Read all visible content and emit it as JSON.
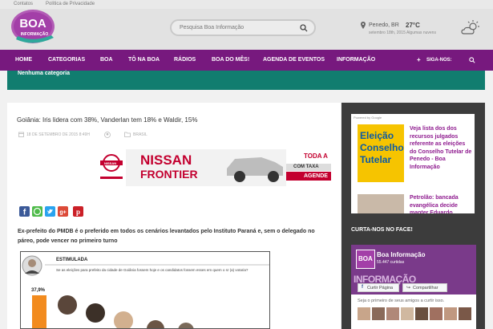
{
  "topbar": {
    "links": [
      "Contatos",
      "Política de Privacidade"
    ]
  },
  "header": {
    "logo_text": "BOA",
    "logo_subtext": "INFORMAÇÃO",
    "search_placeholder": "Pesquisa Boa Informação",
    "weather": {
      "location": "Penedo, BR",
      "temperature": "27°C",
      "date_conditions": "setembro 18th, 2015 Algumas nuvens"
    }
  },
  "nav": {
    "items": [
      "HOME",
      "CATEGORIAS",
      "BOA",
      "TÔ NA BOA",
      "RÁDIOS",
      "BOA DO MÊS!",
      "AGENDA DE EVENTOS",
      "INFORMAÇÃO",
      "SIGA-NOS:"
    ]
  },
  "category_bar": {
    "text": "Nenhuma categoria"
  },
  "article": {
    "title": "Goiânia: Iris lidera com 38%, Vanderlan tem 18% e Waldir, 15%",
    "date": "18 DE SETEMBRO DE 2015 8:49H",
    "category": "BRASIL",
    "ad": {
      "brand": "NISSAN",
      "model": "FRONTIER",
      "text1": "TODA A",
      "text2": "COM TAXA",
      "text3": "AGENDE"
    },
    "lead": "Ex-prefeito do PMDB é o preferido em todos os cenários levantados pelo Instituto Paraná e, sem o delegado no páreo, pode vencer no primeiro turno",
    "infographic": {
      "heading": "ESTIMULADA",
      "question": "Se as eleições para prefeito da cidade de Goiânia fossem hoje e os candidatos fossem esses em quem o sr (a) votaria?",
      "value": "37,9%"
    }
  },
  "sidebar": {
    "ad": {
      "powered": "Powered by Google",
      "story1_image_text": "Eleição Conselho Tutelar",
      "story1_title": "Veja lista dos dos recursos julgados referente as eleições do Conselho Tutelar de Penedo - Boa Informação",
      "story2_title": "Petrolão: bancada evangélica decide manter Eduardo"
    },
    "heading": "CURTA-NOS NO FACE!",
    "facebook": {
      "page_name": "Boa Informação",
      "likes": "55.447 curtidas",
      "like_button": "Curtir Página",
      "share_button": "Compartilhar",
      "cover_text": "INFORMAÇÃO",
      "note": "Seja o primeiro de seus amigos a curtir isso."
    }
  },
  "colors": {
    "nav": "#77197e",
    "category_bar": "#117d6f",
    "sidebar": "#3c3c3c",
    "link": "#8e1a8e"
  }
}
